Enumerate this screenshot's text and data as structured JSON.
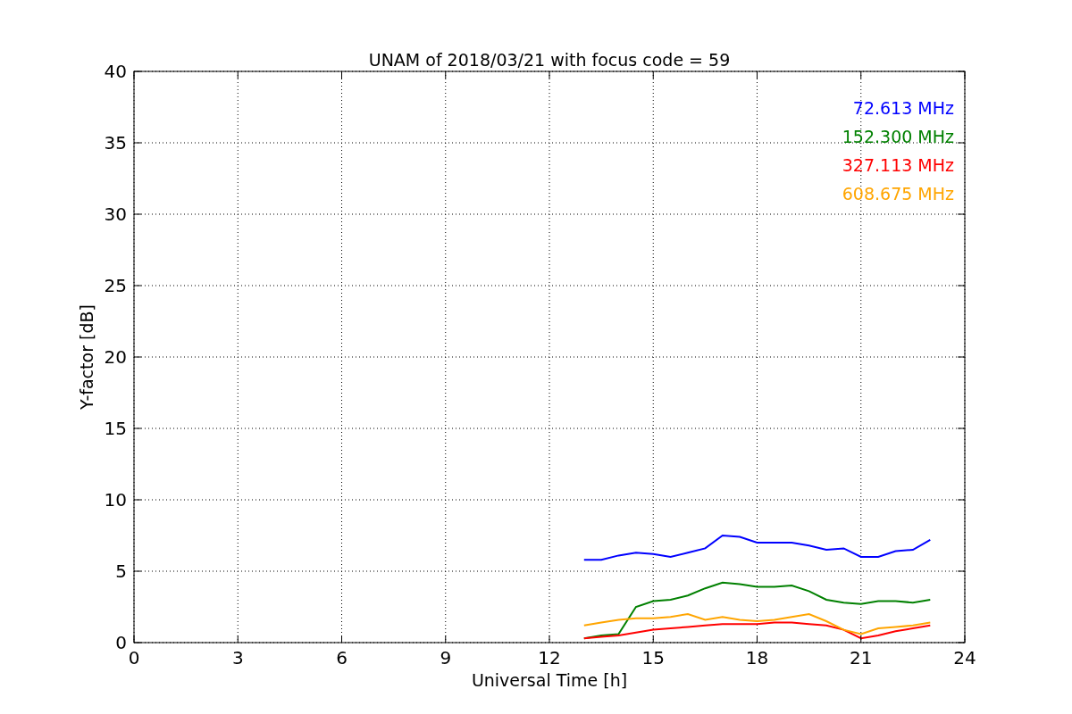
{
  "figure": {
    "chart_data": {
      "type": "line",
      "title": "UNAM of 2018/03/21 with focus code = 59",
      "xlabel": "Universal Time [h]",
      "ylabel": "Y-factor [dB]",
      "x": [
        13,
        13.5,
        14,
        14.5,
        15,
        15.5,
        16,
        16.5,
        17,
        17.5,
        18,
        18.5,
        19,
        19.5,
        20,
        20.5,
        21,
        21.5,
        22,
        22.5,
        23
      ],
      "series": [
        {
          "name": "72.613 MHz",
          "color": "#0000ff",
          "values": [
            5.8,
            5.8,
            6.1,
            6.3,
            6.2,
            6.0,
            6.3,
            6.6,
            7.5,
            7.4,
            7.0,
            7.0,
            7.0,
            6.8,
            6.5,
            6.6,
            6.0,
            6.0,
            6.4,
            6.5,
            7.2
          ]
        },
        {
          "name": "152.300 MHz",
          "color": "#008000",
          "values": [
            0.3,
            0.5,
            0.6,
            2.5,
            2.9,
            3.0,
            3.3,
            3.8,
            4.2,
            4.1,
            3.9,
            3.9,
            4.0,
            3.6,
            3.0,
            2.8,
            2.7,
            2.9,
            2.9,
            2.8,
            3.0
          ]
        },
        {
          "name": "327.113 MHz",
          "color": "#ff0000",
          "values": [
            0.3,
            0.4,
            0.5,
            0.7,
            0.9,
            1.0,
            1.1,
            1.2,
            1.3,
            1.3,
            1.3,
            1.4,
            1.4,
            1.3,
            1.2,
            0.9,
            0.3,
            0.5,
            0.8,
            1.0,
            1.2
          ]
        },
        {
          "name": "608.675 MHz",
          "color": "#ffa500",
          "values": [
            1.2,
            1.4,
            1.6,
            1.7,
            1.7,
            1.8,
            2.0,
            1.6,
            1.8,
            1.6,
            1.5,
            1.6,
            1.8,
            2.0,
            1.5,
            0.9,
            0.6,
            1.0,
            1.1,
            1.2,
            1.4
          ]
        }
      ],
      "xlim": [
        0,
        24
      ],
      "ylim": [
        0,
        40
      ],
      "grid": true,
      "xticks": [
        0,
        3,
        6,
        9,
        12,
        15,
        18,
        21,
        24
      ],
      "yticks": [
        0,
        5,
        10,
        15,
        20,
        25,
        30,
        35,
        40
      ]
    }
  }
}
